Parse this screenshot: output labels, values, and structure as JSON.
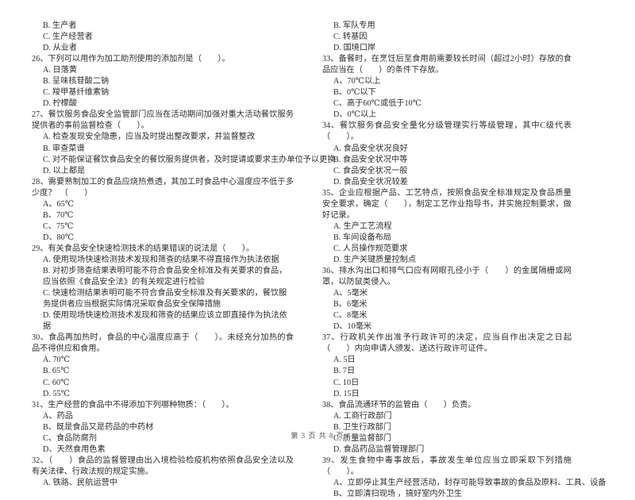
{
  "document": {
    "type": "exam-paper",
    "language": "zh-CN",
    "footer": "第 3 页 共 8 页",
    "page_number": "3",
    "total_pages": "8"
  },
  "left_column": {
    "continued_options": [
      "B. 生产者",
      "C. 生产经营者",
      "D. 从业者"
    ],
    "questions": [
      {
        "number": "26、",
        "stem": "下列可以用作为加工助剂使用的添加剂是（　　）。",
        "options": [
          "A. 日落黄",
          "B. 呈味核苷酸二钠",
          "C. 羧甲基纤维素钠",
          "D. 柠檬酸"
        ]
      },
      {
        "number": "27、",
        "stem": "餐饮服务食品安全监管部门应当在活动期间加强对重大活动餐饮服务提供者的事前监督检查（　　）。",
        "options": [
          "A. 检查发现安全隐患，应当及时提出整改要求，并监督整改",
          "B. 审查菜谱",
          "C. 对不能保证餐饮食品安全的餐饮服务提供者，及时提请或要求主办单位予以更换",
          "D. 以上都是"
        ]
      },
      {
        "number": "28、",
        "stem": "需要熟制加工的食品应烧热煮透，其加工时食品中心温度应不低于多少度？　（　　）",
        "options": [
          "A、65℃",
          "B、70℃",
          "C、75℃",
          "D、80℃"
        ]
      },
      {
        "number": "29、",
        "stem": "有关食品安全快速检测技术的结果错误的说法是（　　）。",
        "options": [
          "A. 使用现场快速检测技术发现和筛查的结果不得直接作为执法依据",
          "B. 对初步筛查结果表明可能不符合食品安全标准及有关要求的食品，应当依照《食品安全法》的有关规定进行检验",
          "C. 快速检测结果表明可能不符合食品安全标准及有关要求的，餐饮服务提供者应当根据实际情况采取食品安全保障措施",
          "D. 使用现场快速检测技术发现和筛查的结果应该立即直接作为执法依据"
        ]
      },
      {
        "number": "30、",
        "stem": "食品再加热时，食品的中心温度应高于（　　）。未经充分加热的食品不得供应和食用。",
        "options": [
          "A. 70℃",
          "B. 65℃",
          "C. 60℃",
          "D. 55℃"
        ]
      },
      {
        "number": "31、",
        "stem": "生产经营的食品中不得添加下列哪种物质：（　　）。",
        "options": [
          "A、药品",
          "B、既是食品又是药品的中药材",
          "C、食品防腐剂",
          "D、天然食用色素"
        ]
      },
      {
        "number": "32、",
        "stem": "（　　）食品的监督管理由出入境检验检疫机构依照食品安全法以及有关法律、行政法规的规定实施。",
        "options": [
          "A. 铁路、民航运营中"
        ]
      }
    ]
  },
  "right_column": {
    "continued_options": [
      "B. 军队专用",
      "C. 转基因",
      "D. 国境口岸"
    ],
    "questions": [
      {
        "number": "33、",
        "stem": "备餐时，在烹饪后至食用前需要较长时间（超过2小时）存放的食品应当在（　　）的条件下存放。",
        "options": [
          "A、70℃以上",
          "B、0℃以下",
          "C、高于60℃或低于10℃",
          "D、0℃以上"
        ]
      },
      {
        "number": "34、",
        "stem": "餐饮服务食品安全量化分级管理实行等级管理，其中C级代表（　　）。",
        "options": [
          "A. 食品安全状况良好",
          "B. 食品安全状况中等",
          "C. 食品安全状况一般",
          "D. 食品安全状况较差"
        ]
      },
      {
        "number": "35、",
        "stem": "企业应根据产品、工艺特点，按照食品安全标准规定及食品质量安全要求，确定（　　），制定工艺作业指导书，并实施控制要求，做好记录。",
        "options": [
          "A. 生产工艺流程",
          "B. 车间设备布局",
          "C. 人员操作规范要求",
          "D. 生产关键质量控制点"
        ]
      },
      {
        "number": "36、",
        "stem": "排水沟出口和排气口应有网眼孔径小于（　　）的金属隔栅或网罩，以防鼠类侵入。",
        "options": [
          "A、5毫米",
          "B、6毫米",
          "C、8毫米",
          "D、10毫米"
        ]
      },
      {
        "number": "37、",
        "stem": "行政机关作出准予行政许可的决定，应当自作出决定之日起（　　）内向申请人颁发、送达行政许可证件。",
        "options": [
          "A. 5日",
          "B. 7日",
          "C. 10日",
          "D. 15日"
        ]
      },
      {
        "number": "38、",
        "stem": "食品流通环节的监管由（　　）负责。",
        "options": [
          "A. 工商行政部门",
          "B. 卫生行政部门",
          "C. 质量监督部门",
          "D. 食品药品监督管理部门"
        ]
      },
      {
        "number": "39、",
        "stem": "发生食物中毒事故后，事故发生单位应当立即采取下列措施（　　）。",
        "options": [
          "A、立即停止其生产经营活动，封存可能导致事故的食品及原料、工具、设备",
          "B、立即清扫现场 ，搞好室内外卫生"
        ]
      }
    ]
  }
}
